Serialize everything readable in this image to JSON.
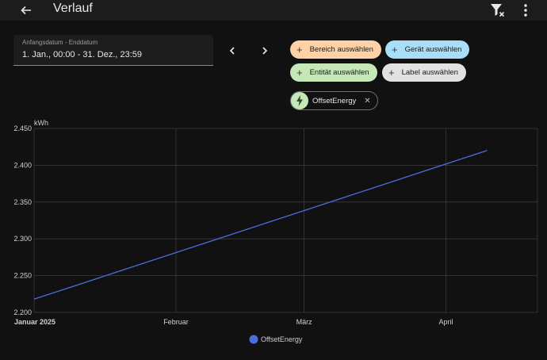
{
  "header": {
    "title": "Verlauf",
    "back_icon": "arrow-left-icon",
    "filter_icon": "filter-remove-icon",
    "menu_icon": "dots-vertical-icon"
  },
  "date_range": {
    "label": "Anfangsdatum - Enddatum",
    "value": "1. Jan., 00:00 - 31. Dez., 23:59"
  },
  "target_chips": [
    {
      "label": "Bereich auswählen",
      "color": "#ffd1a6"
    },
    {
      "label": "Gerät auswählen",
      "color": "#a8def7"
    },
    {
      "label": "Entität auswählen",
      "color": "#c6e7b7"
    },
    {
      "label": "Label auswählen",
      "color": "#e2e2e2"
    }
  ],
  "selected_entity": {
    "label": "OffsetEnergy",
    "icon": "lightning-bolt-icon"
  },
  "chart_data": {
    "type": "line",
    "ylabel": "kWh",
    "ylim": [
      2.2,
      2.45
    ],
    "y_ticks": [
      "2.450",
      "2.400",
      "2.350",
      "2.300",
      "2.250",
      "2.200"
    ],
    "x_ticks": [
      "Januar 2025",
      "Februar",
      "März",
      "April"
    ],
    "grid": true,
    "legend_position": "bottom-center",
    "series": [
      {
        "name": "OffsetEnergy",
        "color": "#4a6fdc",
        "x": [
          "2025-01-01",
          "2025-04-10"
        ],
        "values": [
          2.218,
          2.42
        ]
      }
    ]
  }
}
